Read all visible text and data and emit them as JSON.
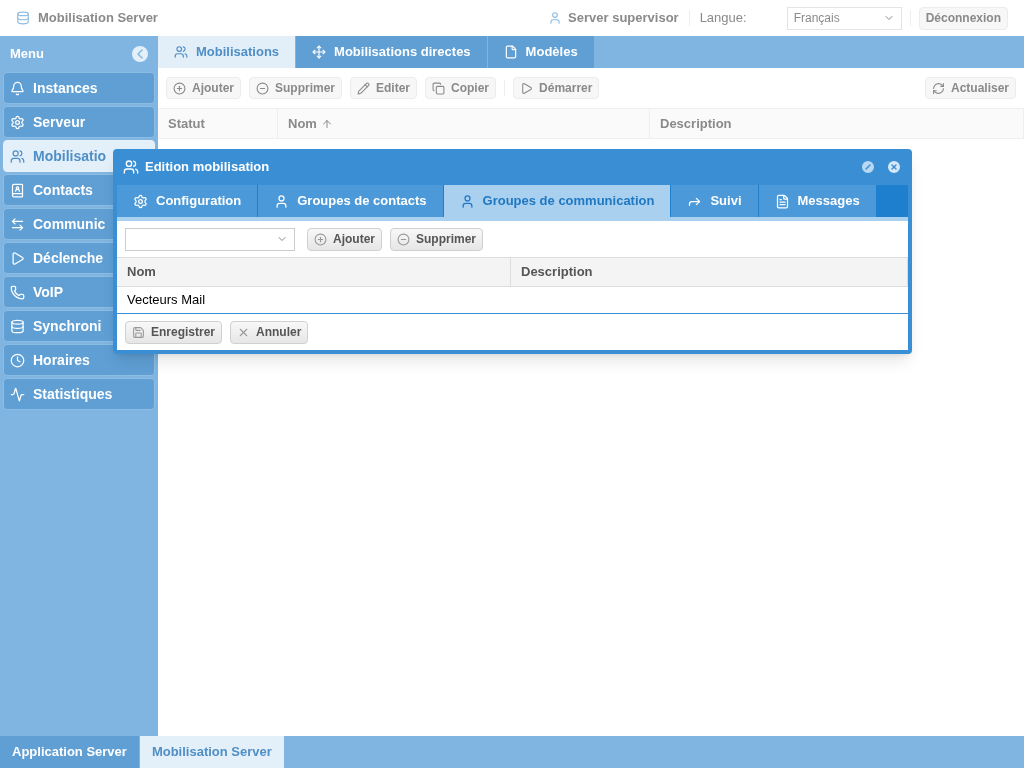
{
  "header": {
    "app_title": "Mobilisation Server",
    "user": "Server supervisor",
    "language_label": "Langue:",
    "language_value": "Français",
    "logout": "Déconnexion"
  },
  "sidebar": {
    "title": "Menu",
    "items": [
      {
        "label": "Instances",
        "selected": false
      },
      {
        "label": "Serveur",
        "selected": false
      },
      {
        "label": "Mobilisatio",
        "selected": true
      },
      {
        "label": "Contacts",
        "selected": false
      },
      {
        "label": "Communic",
        "selected": false
      },
      {
        "label": "Déclenche",
        "selected": false
      },
      {
        "label": "VoIP",
        "selected": false
      },
      {
        "label": "Synchroni",
        "selected": false
      },
      {
        "label": "Horaires",
        "selected": false
      },
      {
        "label": "Statistiques",
        "selected": false
      }
    ]
  },
  "tabs": [
    {
      "label": "Mobilisations",
      "selected": true
    },
    {
      "label": "Mobilisations directes",
      "selected": false
    },
    {
      "label": "Modèles",
      "selected": false
    }
  ],
  "toolbar": {
    "left": [
      "Ajouter",
      "Supprimer",
      "Editer",
      "Copier"
    ],
    "after_separator": [
      "Démarrer"
    ],
    "right": [
      "Actualiser"
    ]
  },
  "table": {
    "columns": [
      {
        "label": "Statut",
        "sorted": false
      },
      {
        "label": "Nom",
        "sorted": true
      },
      {
        "label": "Description",
        "sorted": false
      }
    ]
  },
  "dialog": {
    "title": "Edition mobilisation",
    "tabs": [
      {
        "label": "Configuration",
        "selected": false
      },
      {
        "label": "Groupes de contacts",
        "selected": false
      },
      {
        "label": "Groupes de communication",
        "selected": true
      },
      {
        "label": "Suivi",
        "selected": false
      },
      {
        "label": "Messages",
        "selected": false
      }
    ],
    "toolbar": [
      "Ajouter",
      "Supprimer"
    ],
    "table": {
      "columns": [
        "Nom",
        "Description"
      ],
      "rows": [
        [
          "Vecteurs Mail",
          ""
        ]
      ]
    },
    "footer": [
      "Enregistrer",
      "Annuler"
    ]
  },
  "bottom_tabs": [
    {
      "label": "Application Server",
      "selected": false
    },
    {
      "label": "Mobilisation Server",
      "selected": true
    }
  ]
}
